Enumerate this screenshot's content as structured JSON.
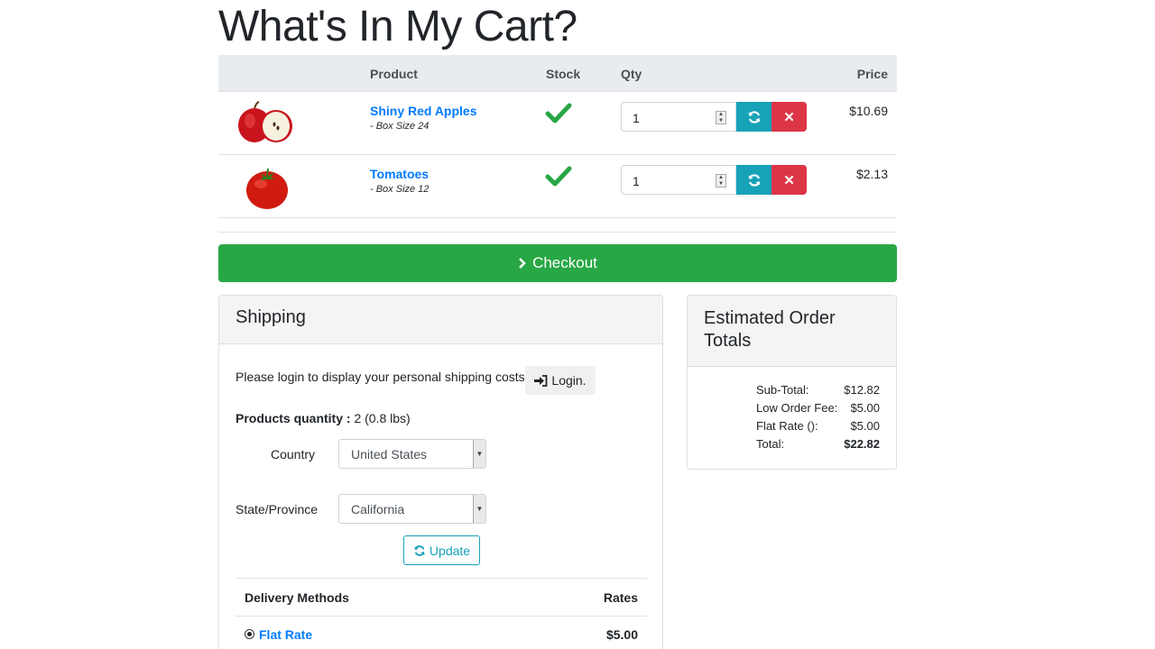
{
  "page": {
    "title": "What's In My Cart?"
  },
  "cart": {
    "headers": {
      "product": "Product",
      "stock": "Stock",
      "qty": "Qty",
      "price": "Price"
    },
    "items": [
      {
        "name": "Shiny Red Apples",
        "variant": "- Box Size 24",
        "qty": "1",
        "price": "$10.69",
        "image": "apple-image"
      },
      {
        "name": "Tomatoes",
        "variant": "- Box Size 12",
        "qty": "1",
        "price": "$2.13",
        "image": "tomato-image"
      }
    ],
    "checkout_label": "Checkout"
  },
  "shipping": {
    "title": "Shipping",
    "login_prompt": "Please login to display your personal shipping costs:",
    "login_label": "Login.",
    "products_quantity_label": "Products quantity :",
    "products_quantity_value": "2 (0.8 lbs)",
    "country_label": "Country",
    "country_value": "United States",
    "state_label": "State/Province",
    "state_value": "California",
    "update_label": "Update",
    "delivery_header": "Delivery Methods",
    "rates_header": "Rates",
    "methods": [
      {
        "name": "Flat Rate",
        "rate": "$5.00",
        "selected": true
      }
    ]
  },
  "totals": {
    "title": "Estimated Order Totals",
    "rows": [
      {
        "label": "Sub-Total:",
        "value": "$12.82"
      },
      {
        "label": "Low Order Fee:",
        "value": "$5.00"
      },
      {
        "label": "Flat Rate ():",
        "value": "$5.00"
      },
      {
        "label": "Total:",
        "value": "$22.82"
      }
    ]
  },
  "colors": {
    "primary": "#007bff",
    "success": "#28a745",
    "info": "#17a2b8",
    "danger": "#dc3545"
  }
}
